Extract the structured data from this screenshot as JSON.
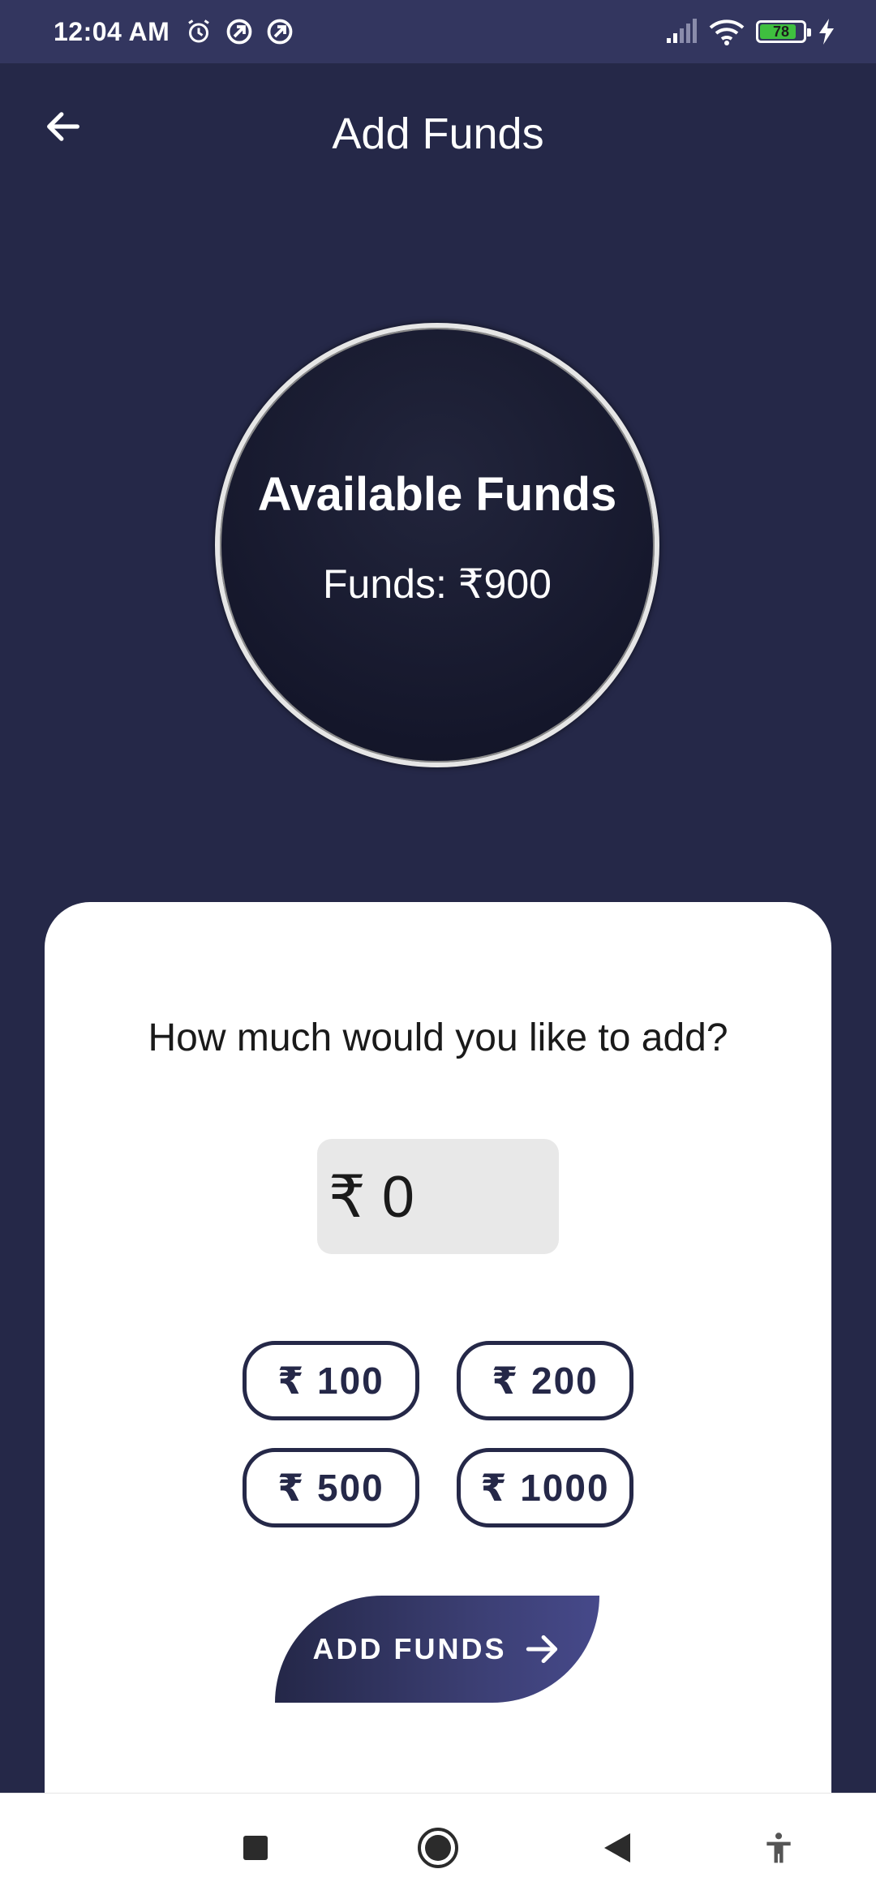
{
  "status_bar": {
    "time": "12:04 AM",
    "battery_level": "78",
    "icons": [
      "alarm-icon",
      "sync-icon",
      "sync-icon",
      "signal-icon",
      "wifi-icon",
      "battery-icon",
      "charging-icon"
    ]
  },
  "header": {
    "title": "Add Funds",
    "back_icon": "arrow-left-icon"
  },
  "funds_card": {
    "heading": "Available Funds",
    "amount": "Funds: ₹900"
  },
  "add_form": {
    "question": "How much would you like to add?",
    "amount_value": "₹ 0",
    "presets": [
      "₹ 100",
      "₹ 200",
      "₹ 500",
      "₹ 1000"
    ],
    "submit_label": "ADD FUNDS",
    "submit_icon": "arrow-right-icon"
  },
  "nav_bar": {
    "items": [
      "recents-square-icon",
      "home-circle-icon",
      "back-triangle-icon",
      "accessibility-icon"
    ]
  },
  "colors": {
    "background": "#252848",
    "status_bar": "#33365f",
    "card": "#ffffff",
    "accent": "#252848",
    "button_gradient_end": "#46498a"
  }
}
